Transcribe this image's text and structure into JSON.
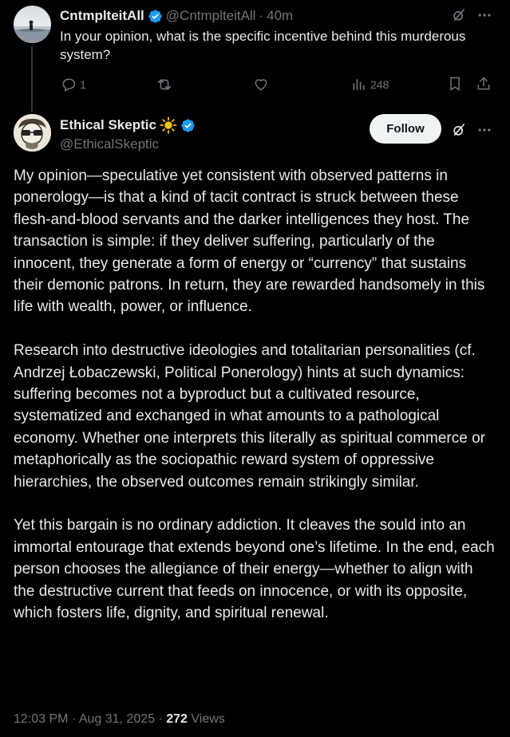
{
  "reply": {
    "name": "CntmplteitAll",
    "handle": "@CntmplteitAll",
    "separator": "·",
    "time": "40m",
    "text": "In your opinion, what is the specific incentive behind this murderous system?",
    "actions": {
      "replies": "1",
      "views": "248"
    }
  },
  "post": {
    "name": "Ethical Skeptic",
    "handle": "@EthicalSkeptic",
    "follow_label": "Follow",
    "paragraphs": [
      "My opinion—speculative yet consistent with observed patterns in ponerology—is that a kind of tacit contract is struck between these flesh-and-blood servants and the darker intelligences they host. The transaction is simple: if they deliver suffering, particularly of the innocent, they generate a form of energy or “currency” that sustains their demonic patrons. In return, they are rewarded handsomely in this life with wealth, power, or influence.",
      "Research into destructive ideologies and totalitarian personalities (cf. Andrzej Łobaczewski, Political Ponerology) hints at such dynamics: suffering becomes not a byproduct but a cultivated resource, systematized and exchanged in what amounts to a pathological economy. Whether one interprets this literally as spiritual commerce or metaphorically as the sociopathic reward system of oppressive hierarchies, the observed outcomes remain strikingly similar.",
      "Yet this bargain is no ordinary addiction. It cleaves the sould into an immortal entourage that extends beyond one’s lifetime. In the end, each person chooses the allegiance of their energy—whether to align with the destructive current that feeds on innocence, or with its opposite, which fosters life, dignity, and spiritual renewal."
    ],
    "timestamp": "12:03 PM · Aug 31, 2025 · ",
    "views_count": "272",
    "views_label": " Views"
  },
  "colors": {
    "background": "#000000",
    "text": "#e7e9ea",
    "muted": "#71767b",
    "verified": "#1d9bf0",
    "sun": "#f9c21a",
    "follow_bg": "#eff3f4"
  },
  "icons": [
    "verified-badge-icon",
    "grok-icon",
    "more-icon",
    "reply-icon",
    "retweet-icon",
    "like-icon",
    "views-icon",
    "bookmark-icon",
    "share-icon",
    "sun-emoji-icon"
  ]
}
